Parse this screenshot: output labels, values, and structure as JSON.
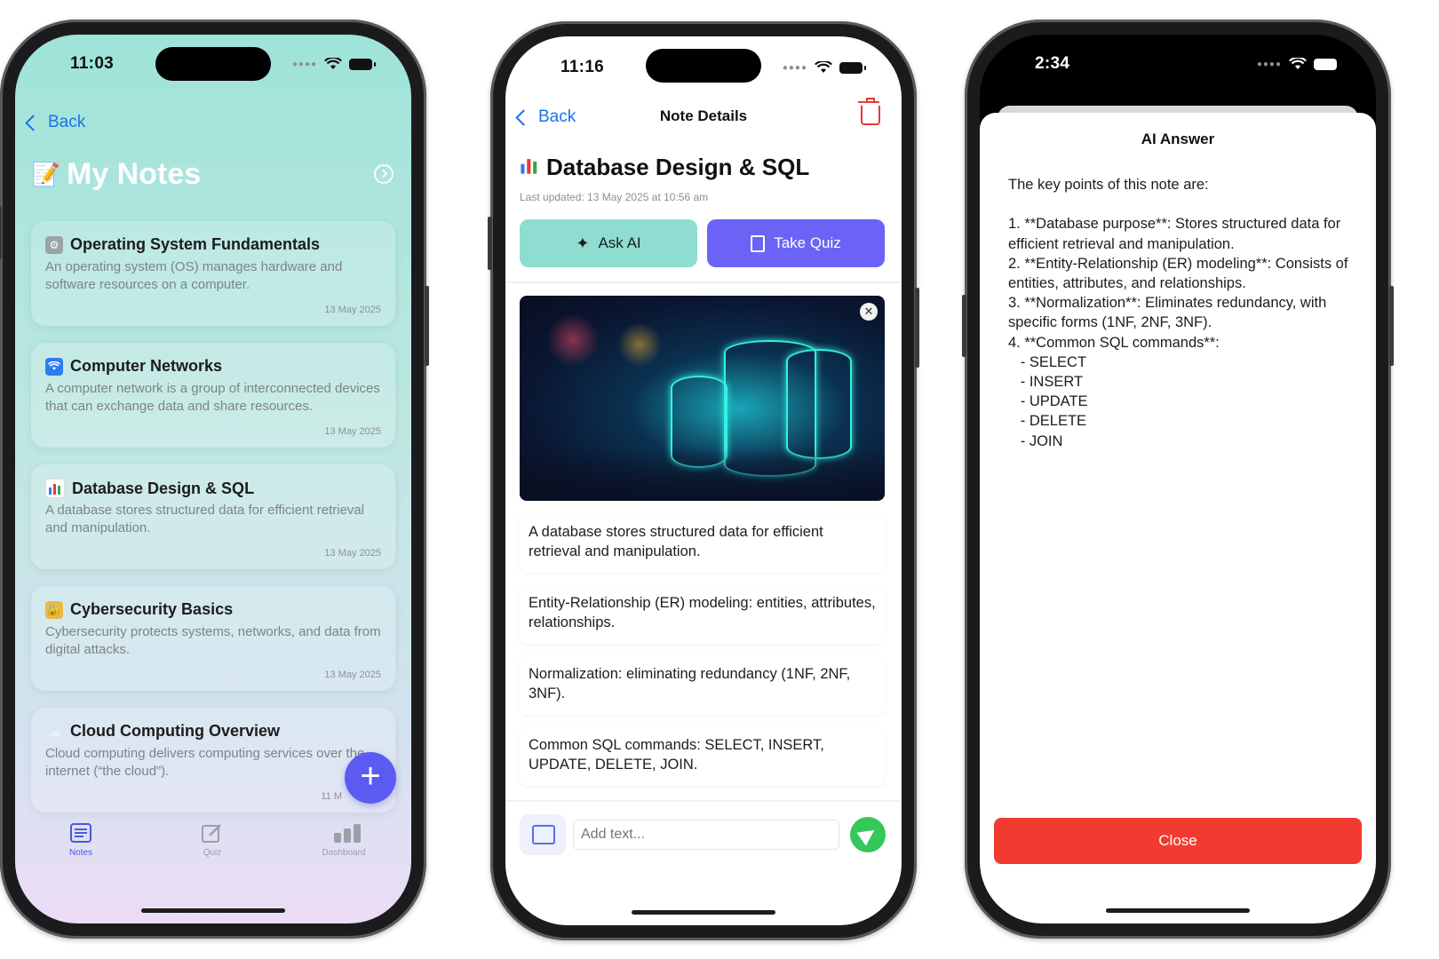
{
  "phone1": {
    "status_time": "11:03",
    "back_label": "Back",
    "title": "My Notes",
    "notes": [
      {
        "title": "Operating System Fundamentals",
        "body": "An operating system (OS) manages hardware and software resources on a computer.",
        "date": "13 May 2025",
        "icon": "gear-icon"
      },
      {
        "title": "Computer Networks",
        "body": "A computer network is a group of interconnected devices that can exchange data and share resources.",
        "date": "13 May 2025",
        "icon": "wifi-icon"
      },
      {
        "title": "Database Design & SQL",
        "body": "A database stores structured data for efficient retrieval and manipulation.",
        "date": "13 May 2025",
        "icon": "bar-chart-icon"
      },
      {
        "title": "Cybersecurity Basics",
        "body": "Cybersecurity protects systems, networks, and data from digital attacks.",
        "date": "13 May 2025",
        "icon": "lock-icon"
      },
      {
        "title": "Cloud Computing Overview",
        "body": "Cloud computing delivers computing services over the internet (“the cloud”).",
        "date": "11 M",
        "icon": "cloud-icon"
      }
    ],
    "tabs": [
      {
        "label": "Notes",
        "icon": "notes-icon",
        "active": true
      },
      {
        "label": "Quiz",
        "icon": "edit-icon",
        "active": false
      },
      {
        "label": "Dashboard",
        "icon": "bar-chart-icon",
        "active": false
      }
    ],
    "fab_label": "+"
  },
  "phone2": {
    "status_time": "11:16",
    "back_label": "Back",
    "nav_title": "Note Details",
    "title": "Database Design & SQL",
    "updated": "Last updated: 13 May 2025 at 10:56 am",
    "ask_ai_label": "Ask AI",
    "take_quiz_label": "Take Quiz",
    "paragraphs": [
      "A database stores structured data for efficient retrieval and manipulation.",
      "Entity-Relationship (ER) modeling: entities, attributes, relationships.",
      "Normalization: eliminating redundancy (1NF, 2NF, 3NF).",
      "Common SQL commands: SELECT, INSERT, UPDATE, DELETE, JOIN."
    ],
    "input_placeholder": "Add text...",
    "colors": {
      "ask_ai": "#8fdcd0",
      "take_quiz": "#6b63f5",
      "send": "#34c759",
      "delete": "#e53935"
    }
  },
  "phone3": {
    "status_time": "2:34",
    "sheet_title": "AI Answer",
    "answer": "The key points of this note are:\n\n1. **Database purpose**: Stores structured data for efficient retrieval and manipulation.\n2. **Entity-Relationship (ER) modeling**: Consists of entities, attributes, and relationships.\n3. **Normalization**: Eliminates redundancy, with specific forms (1NF, 2NF, 3NF).\n4. **Common SQL commands**:\n   - SELECT\n   - INSERT\n   - UPDATE\n   - DELETE\n   - JOIN",
    "close_label": "Close",
    "colors": {
      "close": "#f23b30"
    }
  }
}
